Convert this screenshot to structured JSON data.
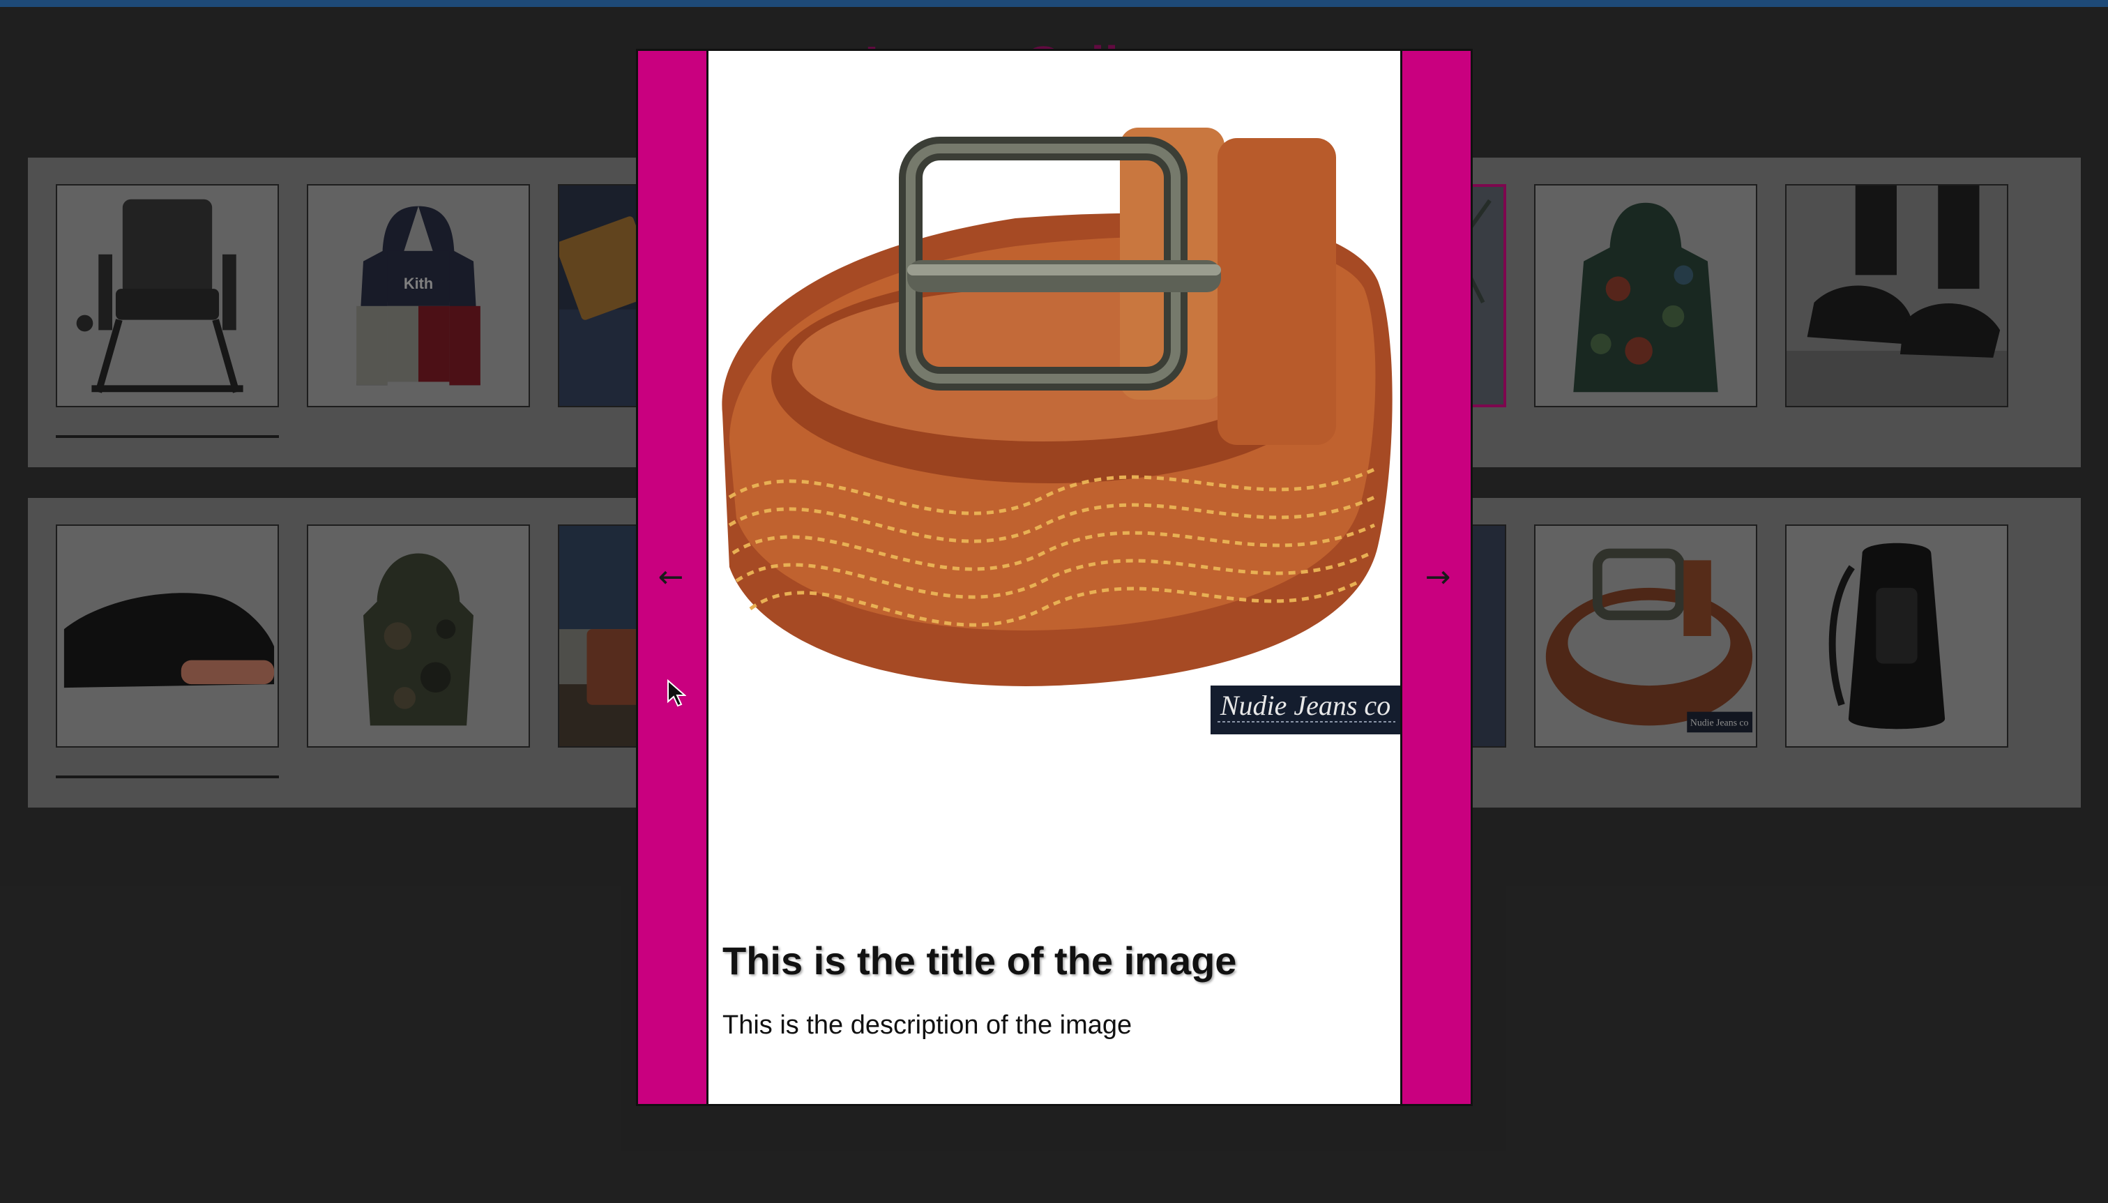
{
  "app": {
    "page_title": "Image Gallery",
    "topbar_color": "#1e4a78",
    "accent_color": "#c9007f"
  },
  "gallery": {
    "rows": [
      {
        "items": [
          {
            "subject": "outdoor chair"
          },
          {
            "subject": "Kith hoodie",
            "text": "Kith"
          },
          {
            "subject": "denim with leather patch"
          },
          {
            "subject": "image (hidden behind modal)"
          },
          {
            "subject": "image (hidden behind modal)"
          },
          {
            "subject": "luggage",
            "selected": true
          },
          {
            "subject": "floral jacket"
          },
          {
            "subject": "black sneakers on steps"
          }
        ]
      },
      {
        "items": [
          {
            "subject": "black sneaker"
          },
          {
            "subject": "camo jacket"
          },
          {
            "subject": "cooler on deck"
          },
          {
            "subject": "image (hidden behind modal)"
          },
          {
            "subject": "image (hidden behind modal)"
          },
          {
            "subject": "jeans"
          },
          {
            "subject": "leather belt",
            "text": "Nudie Jeans co"
          },
          {
            "subject": "black backpack"
          }
        ]
      }
    ]
  },
  "modal": {
    "prev_arrow": "←",
    "next_arrow": "→",
    "image_subject": "brown leather belt with wave stitching",
    "image_logo_text": "Nudie Jeans co",
    "title": "This is the title of the image",
    "description": "This is the description of the image"
  }
}
